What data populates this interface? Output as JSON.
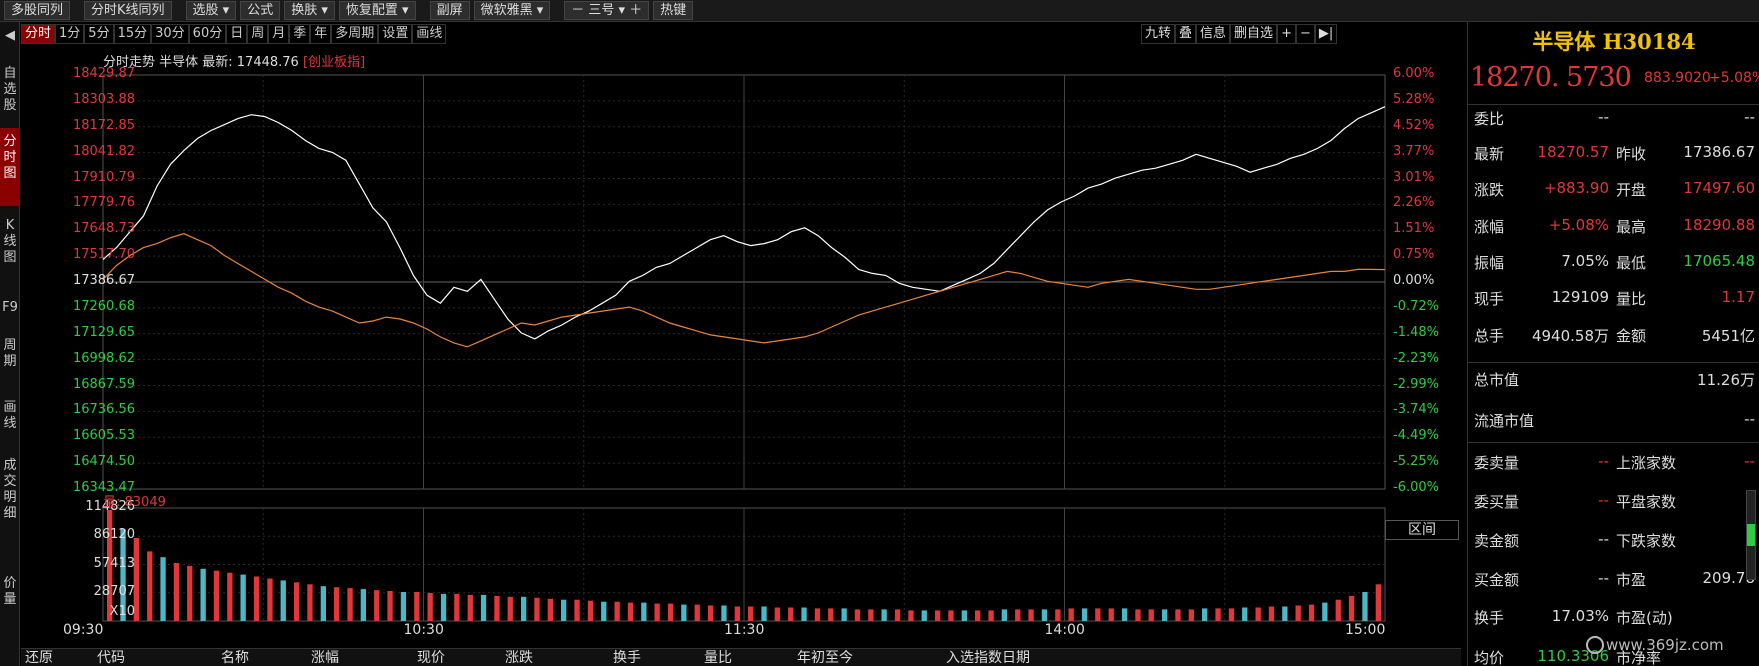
{
  "toolbar": {
    "items": [
      "多股同列",
      "分时K线同列",
      "选股 ▾",
      "公式",
      "换肤 ▾",
      "恢复配置 ▾",
      "副屏",
      "微软雅黑 ▾",
      "－  三号 ▾  ＋",
      "热键"
    ]
  },
  "left_tabs": [
    {
      "label": "◀",
      "active": false
    },
    {
      "label": "自选股",
      "active": false
    },
    {
      "label": "分时图",
      "active": true
    },
    {
      "label": "K线图",
      "active": false
    },
    {
      "label": "F9",
      "active": false
    },
    {
      "label": "周期",
      "active": false
    },
    {
      "label": "画线",
      "active": false
    },
    {
      "label": "成交明细",
      "active": false
    },
    {
      "label": "价量",
      "active": false
    }
  ],
  "period_tabs": [
    {
      "label": "分时",
      "active": true
    },
    {
      "label": "1分",
      "active": false
    },
    {
      "label": "5分",
      "active": false
    },
    {
      "label": "15分",
      "active": false
    },
    {
      "label": "30分",
      "active": false
    },
    {
      "label": "60分",
      "active": false
    },
    {
      "label": "日",
      "active": false
    },
    {
      "label": "周",
      "active": false
    },
    {
      "label": "月",
      "active": false
    },
    {
      "label": "季",
      "active": false
    },
    {
      "label": "年",
      "active": false
    },
    {
      "label": "多周期",
      "active": false
    },
    {
      "label": "设置",
      "active": false
    },
    {
      "label": "画线",
      "active": false
    }
  ],
  "right_buttons": [
    "九转",
    "叠",
    "信息",
    "删自选",
    "+",
    "−",
    "▶|"
  ],
  "chart_header": {
    "prefix": "分时走势  半导体  最新: 17448.76 ",
    "index": "[创业板指]"
  },
  "volume_label": "量: 83049",
  "qujian": "区间",
  "table_headers": [
    "还原",
    "代码",
    "名称",
    "涨幅",
    "现价",
    "涨跌",
    "换手",
    "量比",
    "年初至今",
    "入选指数日期"
  ],
  "panel": {
    "name": "半导体 H30184",
    "price": "18270. 5730",
    "change": "883.9020",
    "change_pct": "+5.08%",
    "rows": [
      {
        "l1": "委比",
        "v1": "--",
        "c1": "white",
        "l2": "",
        "v2": "--",
        "c2": "white"
      },
      {
        "l1": "最新",
        "v1": "18270.57",
        "c1": "red",
        "l2": "昨收",
        "v2": "17386.67",
        "c2": "white"
      },
      {
        "l1": "涨跌",
        "v1": "+883.90",
        "c1": "red",
        "l2": "开盘",
        "v2": "17497.60",
        "c2": "red"
      },
      {
        "l1": "涨幅",
        "v1": "+5.08%",
        "c1": "red",
        "l2": "最高",
        "v2": "18290.88",
        "c2": "red"
      },
      {
        "l1": "振幅",
        "v1": "7.05%",
        "c1": "white",
        "l2": "最低",
        "v2": "17065.48",
        "c2": "green"
      },
      {
        "l1": "现手",
        "v1": "129109",
        "c1": "white",
        "l2": "量比",
        "v2": "1.17",
        "c2": "red"
      },
      {
        "l1": "总手",
        "v1": "4940.58万",
        "c1": "white",
        "l2": "金额",
        "v2": "5451亿",
        "c2": "white"
      },
      {
        "l1": "总市值",
        "v1": "",
        "c1": "white",
        "l2": "",
        "v2": "11.26万",
        "c2": "white"
      },
      {
        "l1": "流通市值",
        "v1": "",
        "c1": "white",
        "l2": "",
        "v2": "--",
        "c2": "white"
      },
      {
        "l1": "委卖量",
        "v1": "--",
        "c1": "red",
        "l2": "上涨家数",
        "v2": "--",
        "c2": "red"
      },
      {
        "l1": "委买量",
        "v1": "--",
        "c1": "red",
        "l2": "平盘家数",
        "v2": "",
        "c2": "white"
      },
      {
        "l1": "卖金额",
        "v1": "--",
        "c1": "white",
        "l2": "下跌家数",
        "v2": "",
        "c2": "white"
      },
      {
        "l1": "买金额",
        "v1": "--",
        "c1": "white",
        "l2": "市盈",
        "v2": "209.78",
        "c2": "white"
      },
      {
        "l1": "换手",
        "v1": "17.03%",
        "c1": "white",
        "l2": "市盈(动)",
        "v2": "",
        "c2": "white"
      },
      {
        "l1": "均价",
        "v1": "110.3306",
        "c1": "green",
        "l2": "市净率",
        "v2": "",
        "c2": "white"
      }
    ]
  },
  "watermark": "www.369jz.com",
  "chart_data": {
    "type": "line",
    "x": [
      "09:30",
      "10:30",
      "11:30",
      "14:00",
      "15:00"
    ],
    "price_ticks": [
      "18429.87",
      "18303.88",
      "18172.85",
      "18041.82",
      "17910.79",
      "17779.76",
      "17648.73",
      "17517.70",
      "17386.67",
      "17260.68",
      "17129.65",
      "16998.62",
      "16867.59",
      "16736.56",
      "16605.53",
      "16474.50",
      "16343.47"
    ],
    "pct_ticks": [
      "6.00%",
      "5.28%",
      "4.52%",
      "3.77%",
      "3.01%",
      "2.26%",
      "1.51%",
      "0.75%",
      "0.00%",
      "-0.72%",
      "-1.48%",
      "-2.23%",
      "-2.99%",
      "-3.74%",
      "-4.49%",
      "-5.25%",
      "-6.00%"
    ],
    "volume_ticks": [
      "114826",
      "86120",
      "57413",
      "28707",
      "X10"
    ],
    "prev_close": 17386.67,
    "ylim": [
      16343.47,
      18429.87
    ],
    "volume_max": 114826,
    "series": [
      {
        "name": "半导体",
        "color": "#ffffff",
        "values": [
          17500,
          17560,
          17640,
          17720,
          17870,
          17980,
          18050,
          18110,
          18150,
          18180,
          18210,
          18230,
          18220,
          18190,
          18150,
          18100,
          18060,
          18040,
          18000,
          17880,
          17760,
          17690,
          17560,
          17420,
          17320,
          17280,
          17360,
          17340,
          17400,
          17300,
          17200,
          17130,
          17100,
          17140,
          17170,
          17210,
          17240,
          17280,
          17320,
          17390,
          17420,
          17460,
          17480,
          17520,
          17560,
          17600,
          17620,
          17590,
          17570,
          17580,
          17600,
          17640,
          17660,
          17620,
          17560,
          17510,
          17450,
          17430,
          17420,
          17380,
          17360,
          17350,
          17340,
          17370,
          17400,
          17430,
          17480,
          17550,
          17620,
          17690,
          17750,
          17790,
          17820,
          17860,
          17880,
          17910,
          17930,
          17950,
          17960,
          17980,
          18000,
          18030,
          18010,
          17990,
          17970,
          17940,
          17960,
          17980,
          18010,
          18030,
          18060,
          18100,
          18160,
          18210,
          18240,
          18270
        ]
      },
      {
        "name": "创业板指",
        "color": "#e9853a",
        "values": [
          17400,
          17470,
          17520,
          17560,
          17580,
          17610,
          17630,
          17600,
          17570,
          17520,
          17480,
          17440,
          17400,
          17360,
          17330,
          17290,
          17260,
          17240,
          17210,
          17180,
          17190,
          17210,
          17200,
          17180,
          17150,
          17110,
          17080,
          17060,
          17090,
          17120,
          17150,
          17180,
          17170,
          17190,
          17210,
          17220,
          17230,
          17240,
          17250,
          17260,
          17240,
          17210,
          17180,
          17160,
          17140,
          17120,
          17110,
          17100,
          17090,
          17080,
          17090,
          17100,
          17110,
          17130,
          17160,
          17190,
          17220,
          17240,
          17260,
          17280,
          17300,
          17320,
          17340,
          17360,
          17380,
          17400,
          17420,
          17440,
          17430,
          17410,
          17390,
          17380,
          17370,
          17360,
          17380,
          17390,
          17400,
          17390,
          17380,
          17370,
          17360,
          17350,
          17350,
          17360,
          17370,
          17380,
          17390,
          17400,
          17410,
          17420,
          17430,
          17440,
          17440,
          17450,
          17450,
          17449
        ]
      },
      {
        "name": "量",
        "color": "#e03838",
        "values": [
          114826,
          95000,
          86000,
          72000,
          66000,
          60000,
          57000,
          54000,
          52000,
          50000,
          48000,
          46000,
          44000,
          42000,
          40000,
          38000,
          36000,
          35000,
          34000,
          33000,
          32000,
          31000,
          30000,
          30000,
          29000,
          28000,
          28000,
          27000,
          27000,
          26000,
          25000,
          25000,
          24000,
          23000,
          22000,
          22000,
          21000,
          20000,
          20000,
          19000,
          19000,
          18000,
          18000,
          17000,
          17000,
          16000,
          16000,
          15000,
          15000,
          15000,
          14000,
          14000,
          14000,
          13000,
          13000,
          13000,
          12000,
          12000,
          12000,
          12000,
          11000,
          11000,
          11000,
          11000,
          11000,
          11000,
          11000,
          12000,
          12000,
          12000,
          12000,
          12000,
          13000,
          13000,
          13000,
          13000,
          13000,
          12000,
          12000,
          12000,
          12000,
          12000,
          13000,
          13000,
          13000,
          14000,
          14000,
          15000,
          15000,
          16000,
          17000,
          19000,
          22000,
          26000,
          30000,
          38000
        ]
      }
    ]
  }
}
